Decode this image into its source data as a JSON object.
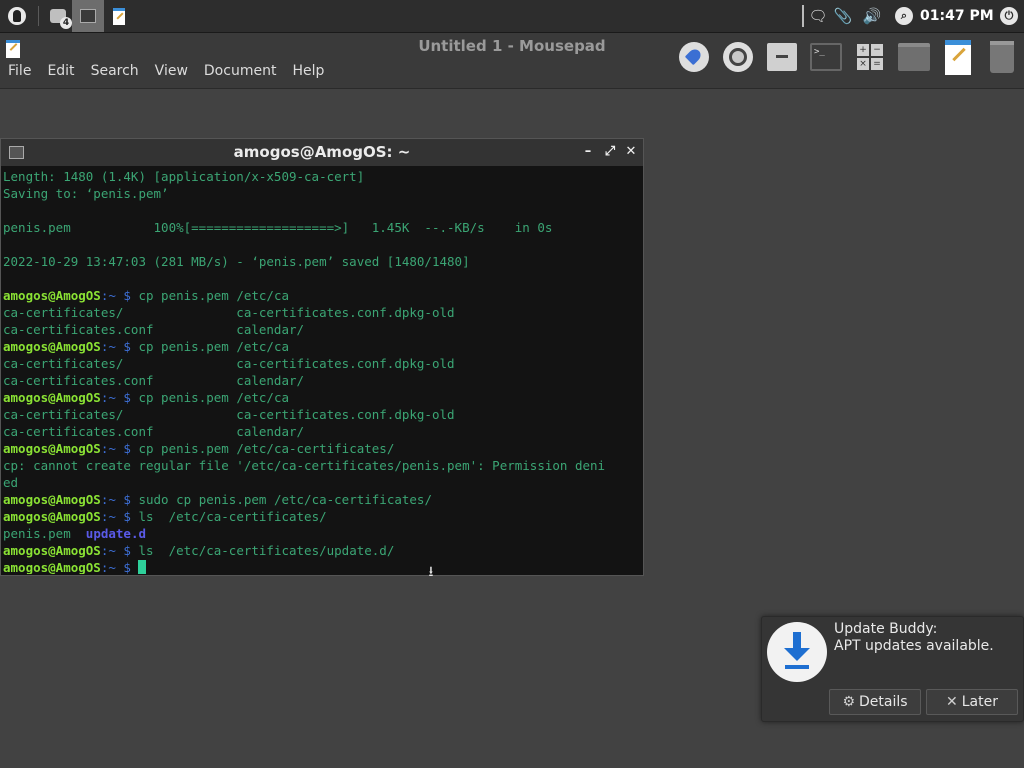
{
  "top_panel": {
    "workspace_count": "4",
    "clock": "01:47 PM",
    "icons": {
      "menu": "distro-menu-icon",
      "workspaces": "workspace-switcher-icon",
      "notifications": "message-icon",
      "clipboard": "paperclip-icon",
      "volume": "speaker-icon",
      "search": "search-icon",
      "power": "power-icon"
    }
  },
  "mousepad": {
    "title": "Untitled 1 - Mousepad",
    "menu": [
      "File",
      "Edit",
      "Search",
      "View",
      "Document",
      "Help"
    ]
  },
  "launcher": [
    "rocket-icon",
    "browser-icon",
    "archive-icon",
    "terminal-icon",
    "calculator-icon",
    "folder-icon",
    "text-editor-icon",
    "trash-icon"
  ],
  "terminal": {
    "title": "amogos@AmogOS: ~",
    "prompt_user": "amogos@AmogOS",
    "prompt_path": ":~ $ ",
    "lines": [
      {
        "type": "out",
        "text": "Length: 1480 (1.4K) [application/x-x509-ca-cert]"
      },
      {
        "type": "out",
        "text": "Saving to: ‘penis.pem’"
      },
      {
        "type": "out",
        "text": ""
      },
      {
        "type": "out",
        "text": "penis.pem           100%[===================>]   1.45K  --.-KB/s    in 0s"
      },
      {
        "type": "out",
        "text": ""
      },
      {
        "type": "out",
        "text": "2022-10-29 13:47:03 (281 MB/s) - ‘penis.pem’ saved [1480/1480]"
      },
      {
        "type": "out",
        "text": ""
      },
      {
        "type": "cmd",
        "text": "cp penis.pem /etc/ca"
      },
      {
        "type": "out",
        "text": "ca-certificates/               ca-certificates.conf.dpkg-old"
      },
      {
        "type": "out",
        "text": "ca-certificates.conf           calendar/"
      },
      {
        "type": "cmd",
        "text": "cp penis.pem /etc/ca"
      },
      {
        "type": "out",
        "text": "ca-certificates/               ca-certificates.conf.dpkg-old"
      },
      {
        "type": "out",
        "text": "ca-certificates.conf           calendar/"
      },
      {
        "type": "cmd",
        "text": "cp penis.pem /etc/ca"
      },
      {
        "type": "out",
        "text": "ca-certificates/               ca-certificates.conf.dpkg-old"
      },
      {
        "type": "out",
        "text": "ca-certificates.conf           calendar/"
      },
      {
        "type": "cmd",
        "text": "cp penis.pem /etc/ca-certificates/"
      },
      {
        "type": "out",
        "text": "cp: cannot create regular file '/etc/ca-certificates/penis.pem': Permission deni"
      },
      {
        "type": "out",
        "text": "ed"
      },
      {
        "type": "cmd",
        "text": "sudo cp penis.pem /etc/ca-certificates/"
      },
      {
        "type": "cmd",
        "text": "ls  /etc/ca-certificates/"
      },
      {
        "type": "ls",
        "file": "penis.pem",
        "dir": "update.d"
      },
      {
        "type": "cmd",
        "text": "ls  /etc/ca-certificates/update.d/"
      },
      {
        "type": "cursor",
        "text": ""
      }
    ]
  },
  "notification": {
    "title": "Update Buddy:",
    "body": "APT updates available.",
    "details_label": "Details",
    "later_label": "Later",
    "icon": "download-icon"
  }
}
